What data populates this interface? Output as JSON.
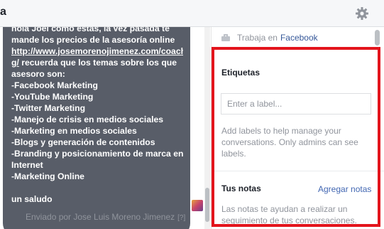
{
  "header": {
    "title": "a",
    "settings_icon": "gear-icon"
  },
  "message": {
    "lines": [
      "hola Joel como estas, la vez pasada te",
      "mande los precios de la asesoría online",
      "",
      "g/ recuerda que los temas sobre los que",
      "asesoro son:",
      "-Facebook Marketing",
      "-YouTube Marketing",
      "-Twitter Marketing",
      "-Manejo de crisis en medios sociales",
      "-Marketing en medios sociales",
      "-Blogs y generación de contenidos",
      "-Branding y posicionamiento de marca en",
      "Internet",
      "-Marketing Online",
      "",
      "un saludo"
    ],
    "link": "http://www.josemorenojimenez.com/coaching/",
    "link_display_line1": "http://www.josemorenojimenez.com/coachin",
    "sent_by": "Enviado por Jose Luis Moreno Jimenez",
    "help_mark": "[?]"
  },
  "profile": {
    "work_prefix": "Trabaja en",
    "company": "Facebook",
    "work_icon": "briefcase-icon"
  },
  "labels": {
    "title": "Etiquetas",
    "input_placeholder": "Enter a label...",
    "input_value": "",
    "help": "Add labels to help manage your conversations. Only admins can see labels."
  },
  "notes": {
    "title": "Tus notas",
    "add_label": "Agregar notas",
    "help": "Las notas te ayudan a realizar un seguimiento de tus conversaciones."
  },
  "colors": {
    "bubble": "#585d68",
    "highlight": "#e3141c",
    "link": "#4267b2",
    "muted": "#90949c"
  }
}
